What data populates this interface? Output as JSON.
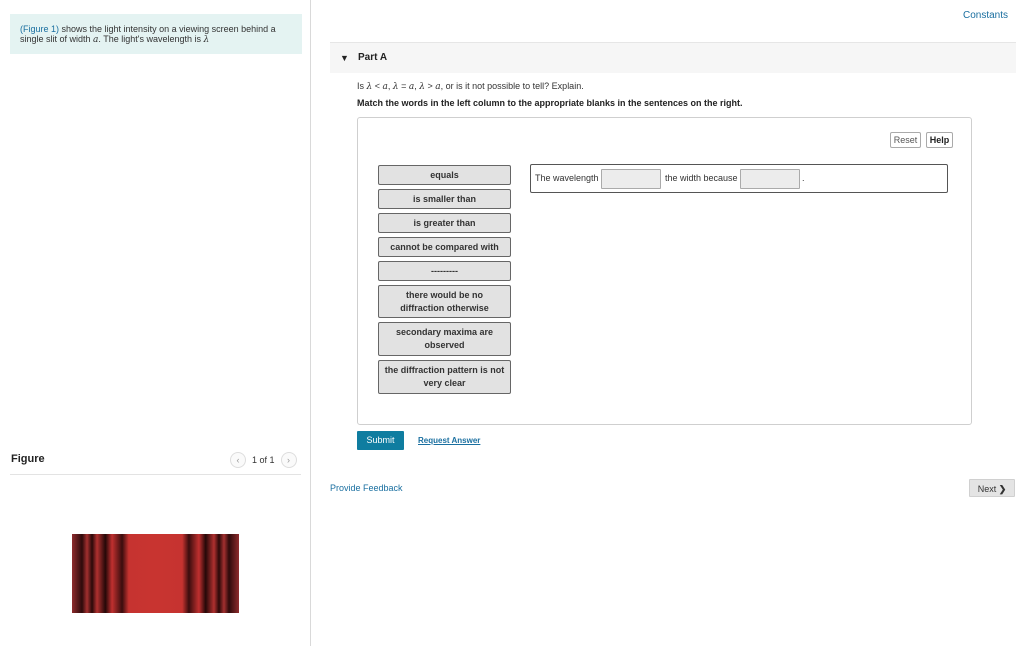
{
  "intro": {
    "figure_link": "(Figure 1)",
    "text_part1": " shows the light intensity on a viewing screen behind a single slit of width ",
    "width_symbol": "a",
    "text_part2": ". The light's wavelength is ",
    "wavelength_symbol": "λ"
  },
  "figure": {
    "label": "Figure",
    "count": "1 of 1",
    "prev_icon": "chevron-left-icon",
    "next_icon": "chevron-right-icon",
    "image": {
      "dark": "#3a0d0e",
      "mid": "#7a2528",
      "bright": "#c0302f"
    }
  },
  "header": {
    "constants_link": "Constants"
  },
  "part": {
    "title": "Part A",
    "caret_icon": "triangle-down-icon"
  },
  "question": {
    "prefix": "Is ",
    "lambda": "λ",
    "lt": " < ",
    "eq": " = ",
    "gt": " > ",
    "a": "a",
    "sep": ", ",
    "suffix": ", or is it not possible to tell? Explain."
  },
  "instruction": "Match the words in the left column to the appropriate blanks in the sentences on the right.",
  "tools": {
    "reset": "Reset",
    "help": "Help"
  },
  "words": [
    "equals",
    "is smaller than",
    "is greater than",
    "cannot be compared with",
    "---------",
    "there would be no diffraction otherwise",
    "secondary maxima are observed",
    "the diffraction pattern is not very clear"
  ],
  "sentence": {
    "part1": "The wavelength",
    "part2": "the width because",
    "part3": "."
  },
  "actions": {
    "submit": "Submit",
    "request_answer": "Request Answer",
    "provide_feedback": "Provide Feedback",
    "next": "Next",
    "next_icon": "chevron-right-icon"
  },
  "colors": {
    "accent": "#0f7da0",
    "link": "#1a6fa0",
    "intro_bg": "#e4f3f2"
  }
}
